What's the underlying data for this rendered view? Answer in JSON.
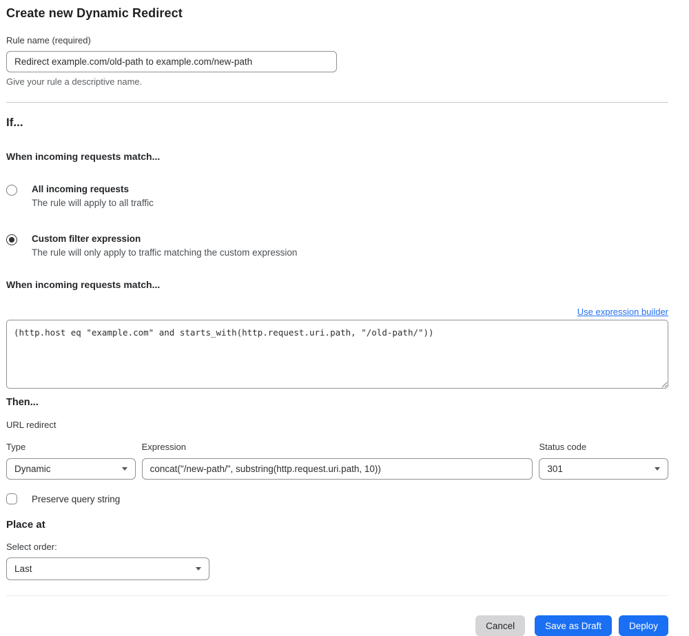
{
  "page": {
    "title": "Create new Dynamic Redirect"
  },
  "rule_name": {
    "label": "Rule name (required)",
    "value": "Redirect example.com/old-path to example.com/new-path",
    "helper": "Give your rule a descriptive name."
  },
  "if_section": {
    "heading": "If...",
    "match_heading": "When incoming requests match...",
    "options": [
      {
        "label": "All incoming requests",
        "description": "The rule will apply to all traffic",
        "selected": false
      },
      {
        "label": "Custom filter expression",
        "description": "The rule will only apply to traffic matching the custom expression",
        "selected": true
      }
    ],
    "expression_heading": "When incoming requests match...",
    "builder_link": "Use expression builder",
    "expression_value": "(http.host eq \"example.com\" and starts_with(http.request.uri.path, \"/old-path/\"))"
  },
  "then_section": {
    "heading": "Then...",
    "action_label": "URL redirect",
    "type": {
      "label": "Type",
      "value": "Dynamic"
    },
    "expression": {
      "label": "Expression",
      "value": "concat(\"/new-path/\", substring(http.request.uri.path, 10))"
    },
    "status_code": {
      "label": "Status code",
      "value": "301"
    },
    "preserve_query_label": "Preserve query string",
    "preserve_query_checked": false
  },
  "place_at": {
    "heading": "Place at",
    "label": "Select order:",
    "value": "Last"
  },
  "footer": {
    "cancel_label": "Cancel",
    "save_draft_label": "Save as Draft",
    "deploy_label": "Deploy"
  },
  "colors": {
    "accent_blue": "#1a6ff3",
    "link_blue": "#2271f0",
    "cancel_gray": "#d5d5d7",
    "border_gray": "#8f9194"
  }
}
